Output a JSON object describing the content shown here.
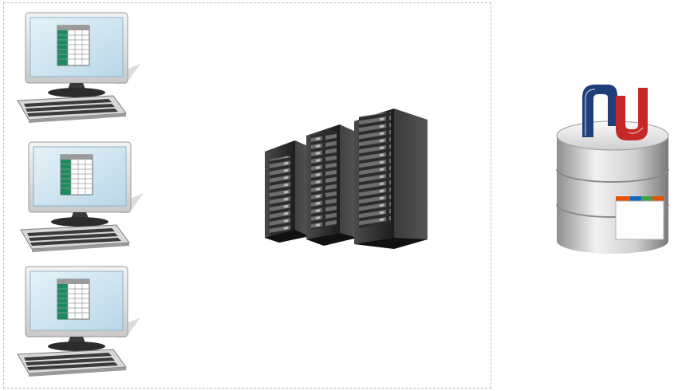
{
  "diagram": {
    "workstations": [
      {
        "icon": "computer-spreadsheet-icon"
      },
      {
        "icon": "computer-spreadsheet-icon"
      },
      {
        "icon": "computer-spreadsheet-icon"
      }
    ],
    "server": {
      "icon": "server-rack-icon"
    },
    "database": {
      "icon": "database-logo-icon"
    }
  },
  "colors": {
    "screen": "#cfe4f0",
    "spreadsheet_accent": "#1e8a5f",
    "rack": "#2a2a2a",
    "logo_blue": "#1f3f7a",
    "logo_red": "#c62828"
  }
}
